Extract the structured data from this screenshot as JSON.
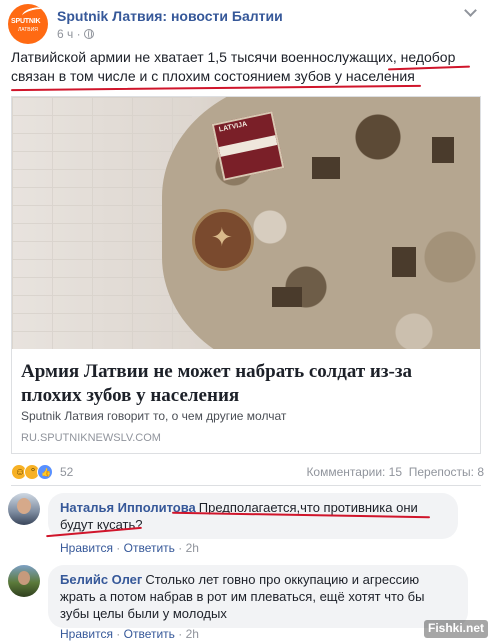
{
  "post": {
    "page_name": "Sputnik Латвия: новости Балтии",
    "time": "6 ч",
    "logo_word": "SPUTNIK",
    "logo_sub": "ЛАТВИЯ",
    "text_part1": "Латвийской армии не хватает 1,5 тысячи военнослужащих, ",
    "text_part2": "недобор связан в том числе и с плохим состоянием зубов у населения"
  },
  "link": {
    "patch_label": "LATVIJA",
    "title": "Армия Латвии не может набрать солдат из-за плохих зубов у населения",
    "description": "Sputnik Латвия говорит то, о чем другие молчат",
    "domain": "RU.SPUTNIKNEWSLV.COM"
  },
  "stats": {
    "reactions_count": "52",
    "comments": "Комментарии: 15",
    "shares": "Перепосты: 8"
  },
  "comments": [
    {
      "author": "Наталья Ипполитова",
      "text": "Предполагается,что противника они будут кусать?",
      "like": "Нравится",
      "reply": "Ответить",
      "time": "2h"
    },
    {
      "author": "Белийс Олег",
      "text": "Столько лет говно про оккупацию и агрессию жрать а потом набрав в рот им плеваться, ещё хотят что бы зубы целы были у молодых",
      "like": "Нравится",
      "reply": "Ответить",
      "time": "2h"
    }
  ],
  "watermark": "Fishki.net",
  "colors": {
    "accent_red": "#d0152b",
    "link_blue": "#365899",
    "brand_orange": "#ff6a13"
  }
}
